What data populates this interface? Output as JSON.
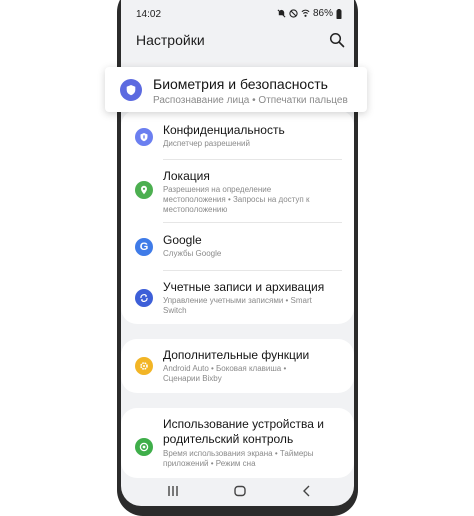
{
  "status": {
    "time": "14:02",
    "battery": "86%"
  },
  "header": {
    "title": "Настройки"
  },
  "highlighted": {
    "label": "Биометрия и безопасность",
    "sub": "Распознавание лица  •  Отпечатки пальцев",
    "color": "#5c6ae0"
  },
  "items": [
    {
      "label": "Конфиденциальность",
      "sub1": "Диспетчер разрешений",
      "sub2": "",
      "color": "#6b7ff0",
      "icon": "privacy-icon"
    },
    {
      "label": "Локация",
      "sub1": "Разрешения на определение",
      "sub2": "местоположения  •  Запросы на доступ к",
      "sub3": "местоположению",
      "color": "#4caf50",
      "icon": "location-icon"
    },
    {
      "label": "Google",
      "sub1": "Службы Google",
      "color": "#3f7be8",
      "icon": "google-icon"
    },
    {
      "label": "Учетные записи и архивация",
      "sub1": "Управление учетными записями  •  Smart",
      "sub2": "Switch",
      "color": "#3d5fd8",
      "icon": "sync-icon"
    },
    {
      "label": "Дополнительные функции",
      "sub1": "Android Auto  •  Боковая клавиша  •",
      "sub2": "Сценарии Bixby",
      "color": "#f2b526",
      "icon": "gear-plus-icon"
    },
    {
      "label": "Использование устройства и",
      "label2": "родительский контроль",
      "sub1": "Время использования экрана  •  Таймеры",
      "sub2": "приложений  •  Режим сна",
      "color": "#3fae4a",
      "icon": "wellbeing-icon"
    }
  ]
}
